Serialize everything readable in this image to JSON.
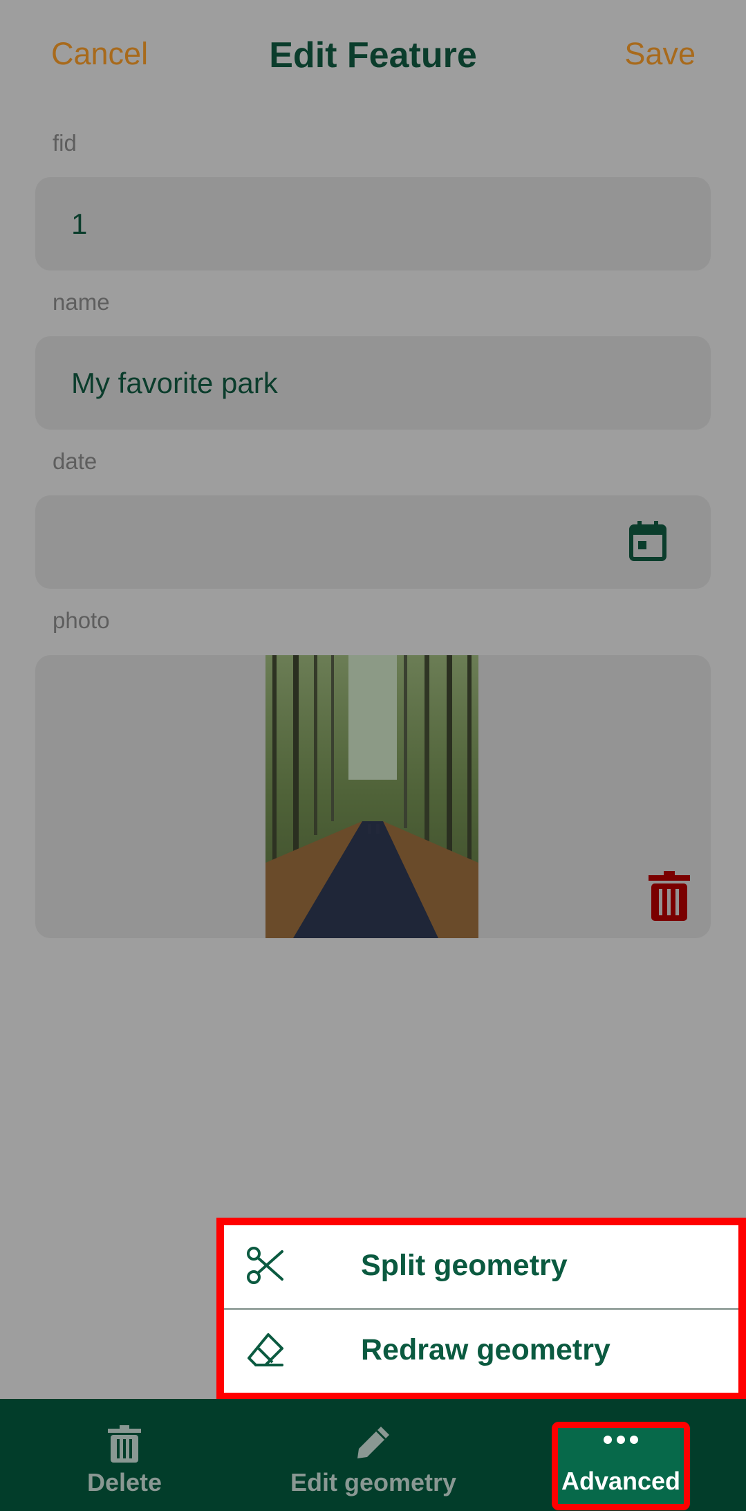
{
  "header": {
    "cancel_label": "Cancel",
    "title": "Edit Feature",
    "save_label": "Save"
  },
  "fields": {
    "fid": {
      "label": "fid",
      "value": "1"
    },
    "name": {
      "label": "name",
      "value": "My favorite park"
    },
    "date": {
      "label": "date",
      "value": ""
    },
    "photo": {
      "label": "photo"
    }
  },
  "menu": {
    "items": [
      {
        "label": "Split geometry",
        "icon": "scissors-icon"
      },
      {
        "label": "Redraw geometry",
        "icon": "eraser-icon"
      }
    ]
  },
  "bottom_bar": {
    "tabs": [
      {
        "label": "Delete",
        "icon": "trash-icon"
      },
      {
        "label": "Edit geometry",
        "icon": "pencil-icon"
      },
      {
        "label": "Advanced",
        "icon": "more-dots-icon"
      }
    ]
  },
  "colors": {
    "accent_green": "#0b5a40",
    "dark_green": "#023d2a",
    "active_tab": "#07694a",
    "header_action": "#a86a1c",
    "highlight": "#ff0000",
    "delete_red": "#7a0000"
  }
}
